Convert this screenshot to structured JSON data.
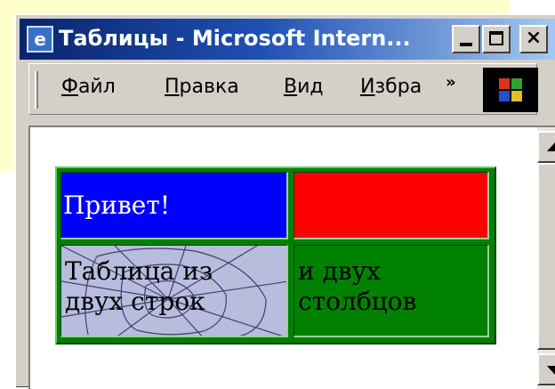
{
  "window": {
    "title": "Таблицы - Microsoft Intern...",
    "buttons": {
      "minimize": "",
      "maximize": "",
      "close": "×"
    }
  },
  "menu": {
    "items": [
      {
        "underlined": "Ф",
        "rest": "айл"
      },
      {
        "underlined": "П",
        "rest": "равка"
      },
      {
        "underlined": "В",
        "rest": "ид"
      },
      {
        "underlined": "И",
        "rest": "збра"
      }
    ],
    "overflow": "»"
  },
  "table": {
    "cells": {
      "r1c1": "Привет!",
      "r1c2": "",
      "r2c1": [
        "Таблица из",
        "двух строк"
      ],
      "r2c2": [
        "и двух",
        "столбцов"
      ]
    },
    "colors": {
      "border_green": "#008000",
      "blue": "#0000ff",
      "red": "#ff0000",
      "green": "#008000",
      "web_bg": "#a8aed4"
    }
  },
  "icons": [
    "ie-page-icon",
    "windows-logo-icon",
    "scroll-up-icon",
    "scroll-down-icon",
    "spiderweb-image"
  ]
}
